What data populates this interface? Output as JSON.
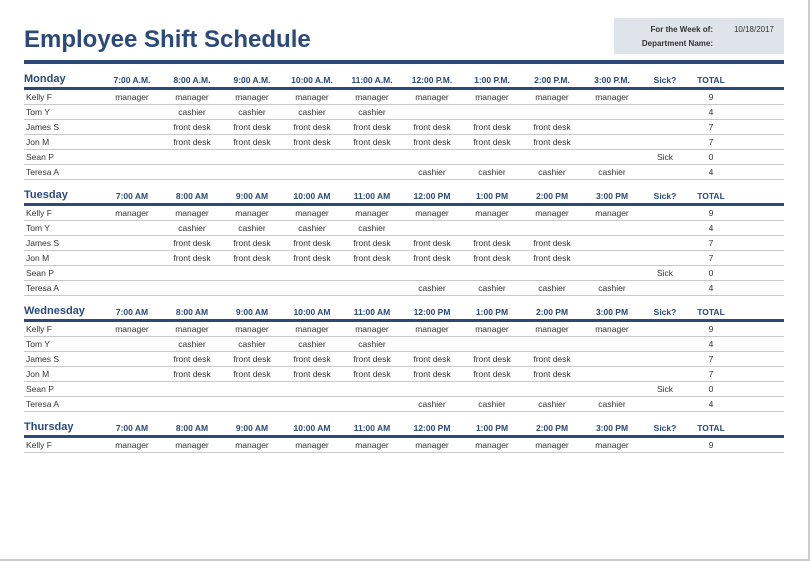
{
  "title": "Employee Shift Schedule",
  "meta": {
    "week_label": "For the Week of:",
    "week_value": "10/18/2017",
    "dept_label": "Department Name:",
    "dept_value": ""
  },
  "common": {
    "sick_header": "Sick?",
    "total_header": "TOTAL"
  },
  "days": [
    {
      "name": "Monday",
      "times": [
        "7:00 A.M.",
        "8:00 A.M.",
        "9:00 A.M.",
        "10:00 A.M.",
        "11:00 A.M.",
        "12:00 P.M.",
        "1:00 P.M.",
        "2:00 P.M.",
        "3:00 P.M."
      ],
      "rows": [
        {
          "name": "Kelly F",
          "slots": [
            "manager",
            "manager",
            "manager",
            "manager",
            "manager",
            "manager",
            "manager",
            "manager",
            "manager"
          ],
          "sick": "",
          "total": "9"
        },
        {
          "name": "Tom Y",
          "slots": [
            "",
            "cashier",
            "cashier",
            "cashier",
            "cashier",
            "",
            "",
            "",
            ""
          ],
          "sick": "",
          "total": "4"
        },
        {
          "name": "James S",
          "slots": [
            "",
            "front desk",
            "front desk",
            "front desk",
            "front desk",
            "front desk",
            "front desk",
            "front desk",
            ""
          ],
          "sick": "",
          "total": "7"
        },
        {
          "name": "Jon M",
          "slots": [
            "",
            "front desk",
            "front desk",
            "front desk",
            "front desk",
            "front desk",
            "front desk",
            "front desk",
            ""
          ],
          "sick": "",
          "total": "7"
        },
        {
          "name": "Sean P",
          "slots": [
            "",
            "",
            "",
            "",
            "",
            "",
            "",
            "",
            ""
          ],
          "sick": "Sick",
          "total": "0"
        },
        {
          "name": "Teresa A",
          "slots": [
            "",
            "",
            "",
            "",
            "",
            "cashier",
            "cashier",
            "cashier",
            "cashier"
          ],
          "sick": "",
          "total": "4"
        }
      ]
    },
    {
      "name": "Tuesday",
      "times": [
        "7:00 AM",
        "8:00 AM",
        "9:00 AM",
        "10:00 AM",
        "11:00 AM",
        "12:00 PM",
        "1:00 PM",
        "2:00 PM",
        "3:00 PM"
      ],
      "rows": [
        {
          "name": "Kelly F",
          "slots": [
            "manager",
            "manager",
            "manager",
            "manager",
            "manager",
            "manager",
            "manager",
            "manager",
            "manager"
          ],
          "sick": "",
          "total": "9"
        },
        {
          "name": "Tom Y",
          "slots": [
            "",
            "cashier",
            "cashier",
            "cashier",
            "cashier",
            "",
            "",
            "",
            ""
          ],
          "sick": "",
          "total": "4"
        },
        {
          "name": "James S",
          "slots": [
            "",
            "front desk",
            "front desk",
            "front desk",
            "front desk",
            "front desk",
            "front desk",
            "front desk",
            ""
          ],
          "sick": "",
          "total": "7"
        },
        {
          "name": "Jon M",
          "slots": [
            "",
            "front desk",
            "front desk",
            "front desk",
            "front desk",
            "front desk",
            "front desk",
            "front desk",
            ""
          ],
          "sick": "",
          "total": "7"
        },
        {
          "name": "Sean P",
          "slots": [
            "",
            "",
            "",
            "",
            "",
            "",
            "",
            "",
            ""
          ],
          "sick": "Sick",
          "total": "0"
        },
        {
          "name": "Teresa A",
          "slots": [
            "",
            "",
            "",
            "",
            "",
            "cashier",
            "cashier",
            "cashier",
            "cashier"
          ],
          "sick": "",
          "total": "4"
        }
      ]
    },
    {
      "name": "Wednesday",
      "times": [
        "7:00 AM",
        "8:00 AM",
        "9:00 AM",
        "10:00 AM",
        "11:00 AM",
        "12:00 PM",
        "1:00 PM",
        "2:00 PM",
        "3:00 PM"
      ],
      "rows": [
        {
          "name": "Kelly F",
          "slots": [
            "manager",
            "manager",
            "manager",
            "manager",
            "manager",
            "manager",
            "manager",
            "manager",
            "manager"
          ],
          "sick": "",
          "total": "9"
        },
        {
          "name": "Tom Y",
          "slots": [
            "",
            "cashier",
            "cashier",
            "cashier",
            "cashier",
            "",
            "",
            "",
            ""
          ],
          "sick": "",
          "total": "4"
        },
        {
          "name": "James S",
          "slots": [
            "",
            "front desk",
            "front desk",
            "front desk",
            "front desk",
            "front desk",
            "front desk",
            "front desk",
            ""
          ],
          "sick": "",
          "total": "7"
        },
        {
          "name": "Jon M",
          "slots": [
            "",
            "front desk",
            "front desk",
            "front desk",
            "front desk",
            "front desk",
            "front desk",
            "front desk",
            ""
          ],
          "sick": "",
          "total": "7"
        },
        {
          "name": "Sean P",
          "slots": [
            "",
            "",
            "",
            "",
            "",
            "",
            "",
            "",
            ""
          ],
          "sick": "Sick",
          "total": "0"
        },
        {
          "name": "Teresa A",
          "slots": [
            "",
            "",
            "",
            "",
            "",
            "cashier",
            "cashier",
            "cashier",
            "cashier"
          ],
          "sick": "",
          "total": "4"
        }
      ]
    },
    {
      "name": "Thursday",
      "times": [
        "7:00 AM",
        "8:00 AM",
        "9:00 AM",
        "10:00 AM",
        "11:00 AM",
        "12:00 PM",
        "1:00 PM",
        "2:00 PM",
        "3:00 PM"
      ],
      "rows": [
        {
          "name": "Kelly F",
          "slots": [
            "manager",
            "manager",
            "manager",
            "manager",
            "manager",
            "manager",
            "manager",
            "manager",
            "manager"
          ],
          "sick": "",
          "total": "9"
        }
      ]
    }
  ]
}
